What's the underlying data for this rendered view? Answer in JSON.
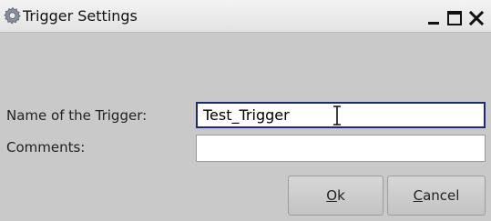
{
  "window": {
    "title": "Trigger Settings",
    "icon": "gear-icon",
    "controls": [
      "minimize-icon",
      "maximize-icon",
      "close-icon"
    ]
  },
  "form": {
    "name_label": "Name of the Trigger:",
    "name_value": "Test_Trigger",
    "comments_label": "Comments:",
    "comments_value": ""
  },
  "buttons": {
    "ok": {
      "mnemonic": "O",
      "rest": "k"
    },
    "cancel": {
      "mnemonic": "C",
      "rest": "ancel"
    }
  },
  "colors": {
    "focus_border": "#1e2a6e",
    "dialog_background": "#c9c9c9"
  }
}
